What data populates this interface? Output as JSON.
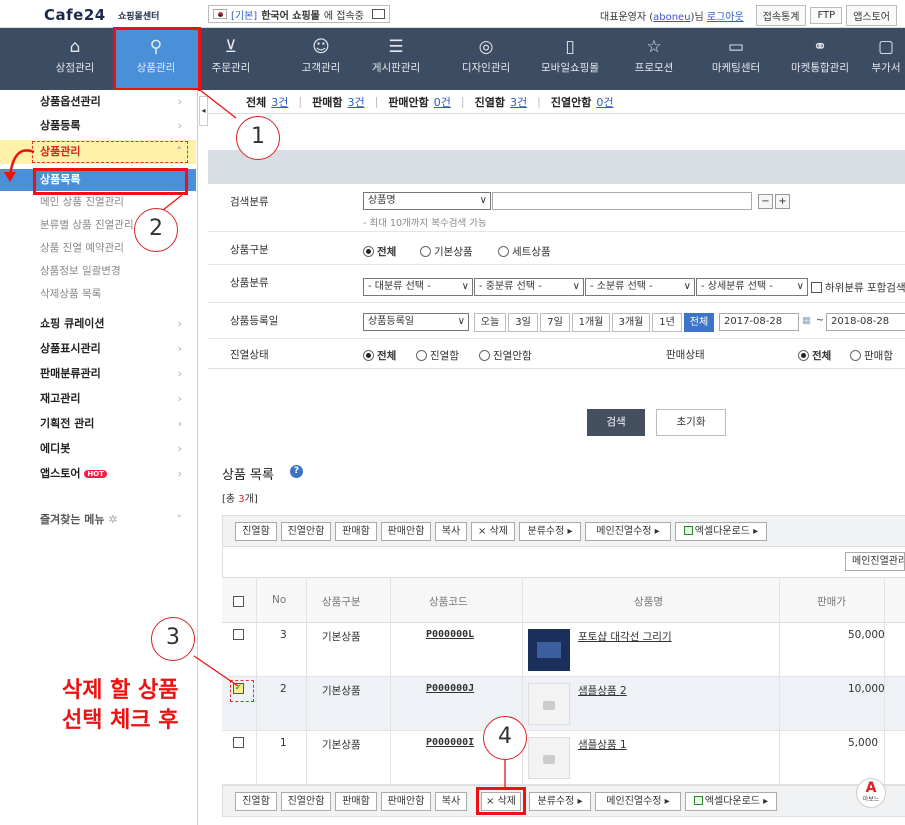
{
  "topbar": {
    "logo": "Cafe24",
    "logo_sub": "쇼핑몰센터",
    "mall_tag": "[기본]",
    "mall_name": "한국어 쇼핑몰",
    "mall_suffix": "에 접속중",
    "owner_prefix": "대표운영자 (",
    "owner_id": "aboneu",
    "owner_suffix": ")님",
    "logout": "로그아웃",
    "buttons": [
      "접속통계",
      "FTP",
      "앱스토어"
    ]
  },
  "mainnav": [
    {
      "label": "상점관리",
      "icon": "home-icon"
    },
    {
      "label": "상품관리",
      "icon": "shirt-icon"
    },
    {
      "label": "주문관리",
      "icon": "cart-icon"
    },
    {
      "label": "고객관리",
      "icon": "users-icon"
    },
    {
      "label": "게시판관리",
      "icon": "board-icon"
    },
    {
      "label": "디자인관리",
      "icon": "palette-icon"
    },
    {
      "label": "모바일쇼핑몰",
      "icon": "mobile-icon"
    },
    {
      "label": "프로모션",
      "icon": "star-icon"
    },
    {
      "label": "마케팅센터",
      "icon": "marketing-icon"
    },
    {
      "label": "마켓통합관리",
      "icon": "network-icon"
    },
    {
      "label": "부가서",
      "icon": "addon-icon"
    }
  ],
  "sidebar": {
    "items_top": [
      "상품옵션관리",
      "상품등록"
    ],
    "group": "상품관리",
    "active": "상품목록",
    "subs": [
      "메인 상품 진열관리",
      "분류별 상품 진열관리",
      "상품 진열 예약관리",
      "상품정보 일괄변경",
      "삭제상품 목록"
    ],
    "items_bottom": [
      "쇼핑 큐레이션",
      "상품표시관리",
      "판매분류관리",
      "재고관리",
      "기획전 관리",
      "에디봇"
    ],
    "appstore": "앱스토어",
    "hot": "HOT",
    "favorites": "즐겨찾는 메뉴"
  },
  "status": [
    {
      "label": "전체",
      "count": "3건"
    },
    {
      "label": "판매함",
      "count": "3건"
    },
    {
      "label": "판매안함",
      "count": "0건"
    },
    {
      "label": "진열함",
      "count": "3건"
    },
    {
      "label": "진열안함",
      "count": "0건"
    }
  ],
  "search": {
    "category_label": "검색분류",
    "category_select": "상품명",
    "category_hint": "- 최대 10개까지 복수검색 가능",
    "type_label": "상품구분",
    "type_options": [
      "전체",
      "기본상품",
      "세트상품"
    ],
    "class_label": "상품분류",
    "class_selects": [
      "- 대분류 선택 -",
      "- 중분류 선택 -",
      "- 소분류 선택 -",
      "- 상세분류 선택 -"
    ],
    "class_sub_check": "하위분류 포함검색",
    "date_label": "상품등록일",
    "date_select": "상품등록일",
    "date_buttons": [
      "오늘",
      "3일",
      "7일",
      "1개월",
      "3개월",
      "1년",
      "전체"
    ],
    "date_from": "2017-08-28",
    "date_tilde": "~",
    "date_to": "2018-08-28",
    "display_label": "진열상태",
    "display_options": [
      "전체",
      "진열함",
      "진열안함"
    ],
    "sale_label": "판매상태",
    "sale_options": [
      "전체",
      "판매함"
    ],
    "search_btn": "검색",
    "reset_btn": "초기화"
  },
  "list": {
    "title": "상품 목록",
    "total_prefix": "[총 ",
    "total_count": "3",
    "total_suffix": "개]",
    "toolbar": [
      "진열함",
      "진열안함",
      "판매함",
      "판매안함",
      "복사",
      "× 삭제",
      "분류수정 ▸",
      "메인진열수정 ▸",
      "엑셀다운로드 ▸"
    ],
    "main_exhibit_btn": "메인진열관리",
    "headers": [
      "No",
      "상품구분",
      "상품코드",
      "상품명",
      "판매가"
    ],
    "rows": [
      {
        "no": "3",
        "type": "기본상품",
        "code": "P000000L",
        "name": "포토샵 대각선 그리기",
        "price": "50,000",
        "checked": false
      },
      {
        "no": "2",
        "type": "기본상품",
        "code": "P000000J",
        "name": "샘플상품 2",
        "price": "10,000",
        "checked": true
      },
      {
        "no": "1",
        "type": "기본상품",
        "code": "P000000I",
        "name": "샘플상품 1",
        "price": "5,000",
        "checked": false
      }
    ]
  },
  "annotations": {
    "circles": [
      "1",
      "2",
      "3",
      "4"
    ],
    "note_line1": "삭제 할 상품",
    "note_line2": "선택 체크 후",
    "badge_letter": "A",
    "badge_sub": "아보느"
  }
}
